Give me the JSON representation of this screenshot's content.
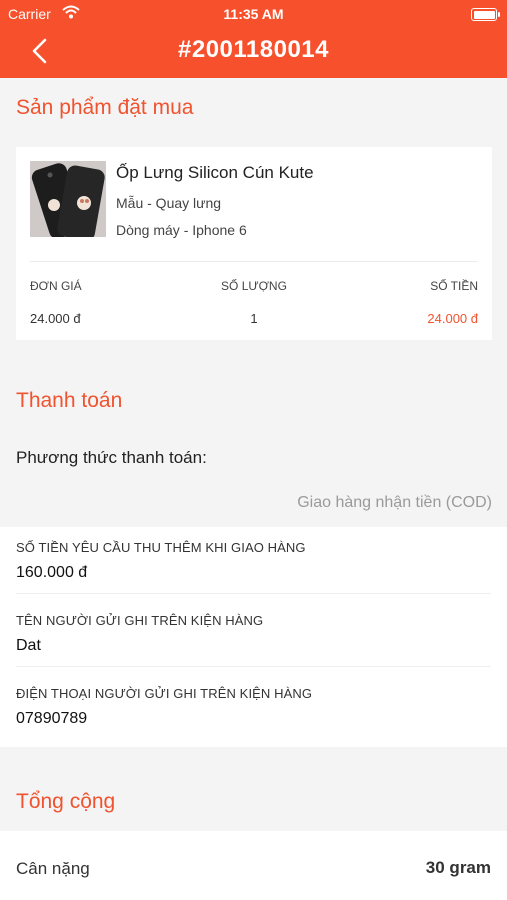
{
  "status_bar": {
    "carrier": "Carrier",
    "time": "11:35 AM"
  },
  "header": {
    "title": "#2001180014",
    "color": "#f6502d"
  },
  "sections": {
    "products": "Sản phẩm đặt mua",
    "payment": "Thanh toán",
    "total": "Tổng cộng"
  },
  "product": {
    "name": "Ốp Lưng Silicon Cún Kute",
    "variant": "Mẫu - Quay lưng",
    "model": "Dòng máy - Iphone 6",
    "columns": {
      "unit_price": "ĐƠN GIÁ",
      "quantity": "SỐ LƯỢNG",
      "amount": "SỐ TIỀN"
    },
    "unit_price": "24.000 đ",
    "quantity": "1",
    "amount": "24.000 đ"
  },
  "payment": {
    "method_label": "Phương thức thanh toán:",
    "method_value": "Giao hàng nhận tiền (COD)"
  },
  "fields": [
    {
      "label": "SỐ TIỀN YÊU CẦU THU THÊM KHI GIAO HÀNG",
      "value": "160.000 đ"
    },
    {
      "label": "TÊN NGƯỜI GỬI GHI TRÊN KIỆN HÀNG",
      "value": "Dat"
    },
    {
      "label": "ĐIỆN THOẠI NGƯỜI GỬI GHI TRÊN KIỆN HÀNG",
      "value": "07890789"
    }
  ],
  "summary": {
    "weight_label": "Cân nặng",
    "weight_value": "30 gram"
  },
  "icons": {
    "back": "chevron-left-icon",
    "wifi": "wifi-icon",
    "battery": "battery-icon"
  },
  "colors": {
    "accent": "#f0532f",
    "background": "#f4f4f4"
  }
}
